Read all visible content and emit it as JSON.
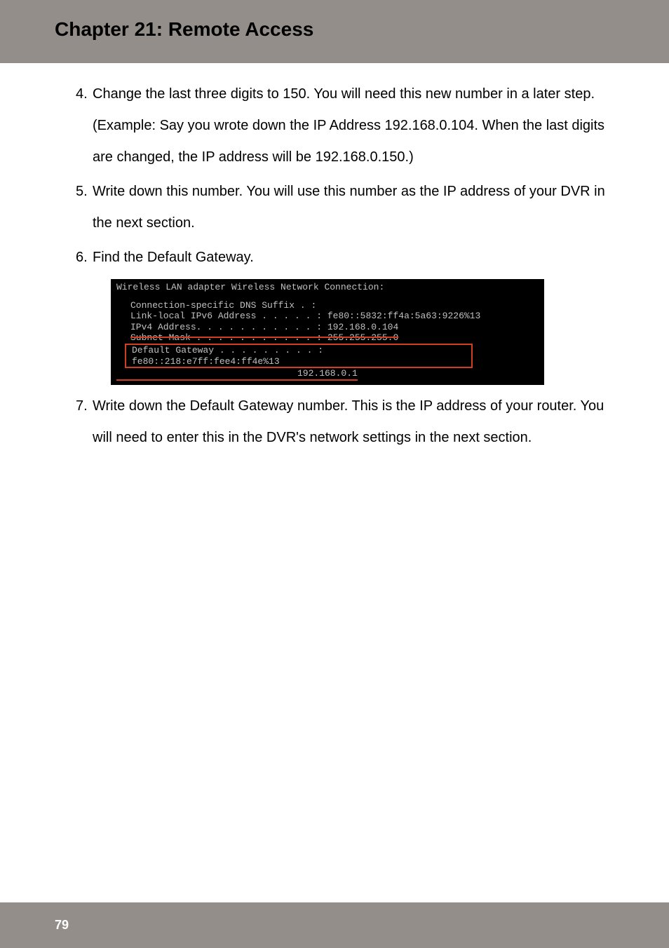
{
  "header": {
    "title": "Chapter 21: Remote Access"
  },
  "items": [
    {
      "num": "4.",
      "text": "Change the last three digits to 150. You will need this new number in a later step. (Example: Say you wrote down the IP Address 192.168.0.104. When the last digits are changed, the IP address will be 192.168.0.150.)"
    },
    {
      "num": "5.",
      "text": "Write down this number. You will use this number as the IP address of your DVR in the next section."
    },
    {
      "num": "6.",
      "text": "Find the Default Gateway."
    },
    {
      "num": "7.",
      "text": "Write down the Default Gateway number. This is the IP address of your router. You will need to enter this in the DVR's network settings in the next section."
    }
  ],
  "terminal": {
    "line1": "Wireless LAN adapter Wireless Network Connection:",
    "line2": "Connection-specific DNS Suffix  . :",
    "line3": "Link-local IPv6 Address . . . . . : fe80::5832:ff4a:5a63:9226%13",
    "line4": "IPv4 Address. . . . . . . . . . . : 192.168.0.104",
    "line5": "Subnet Mask . . . . . . . . . . . : 255.255.255.0",
    "line6": "Default Gateway . . . . . . . . . : fe80::218:e7ff:fee4:ff4e%13",
    "line7": "192.168.0.1"
  },
  "footer": {
    "page": "79"
  }
}
